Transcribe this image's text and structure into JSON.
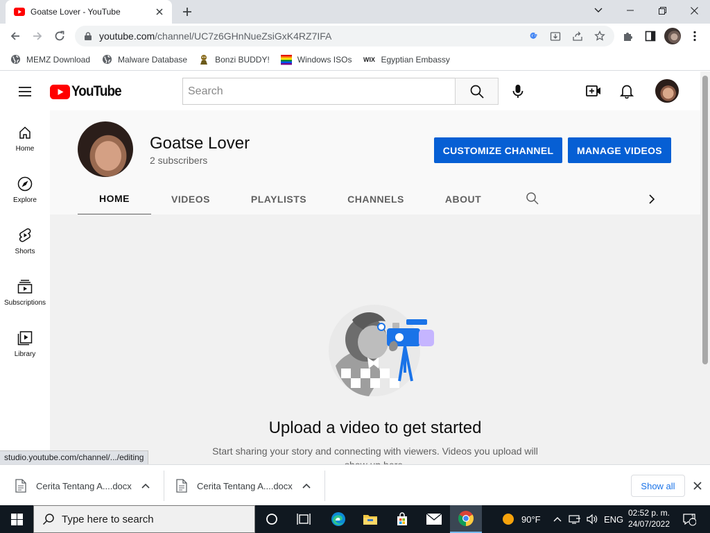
{
  "browser": {
    "tab_title": "Goatse Lover - YouTube",
    "url_host": "youtube.com",
    "url_path": "/channel/UC7z6GHnNueZsiGxK4RZ7IFA",
    "bookmarks": [
      {
        "label": "MEMZ Download",
        "icon": "globe-icon"
      },
      {
        "label": "Malware Database",
        "icon": "globe-icon"
      },
      {
        "label": "Bonzi BUDDY!",
        "icon": "bonzi-icon"
      },
      {
        "label": "Windows ISOs",
        "icon": "windows-flag-icon"
      },
      {
        "label": "Egyptian Embassy",
        "icon": "wix-icon"
      }
    ],
    "status_url": "studio.youtube.com/channel/.../editing"
  },
  "youtube": {
    "logo_text": "YouTube",
    "search_placeholder": "Search",
    "sidebar": [
      {
        "label": "Home",
        "icon": "home-icon"
      },
      {
        "label": "Explore",
        "icon": "compass-icon"
      },
      {
        "label": "Shorts",
        "icon": "shorts-icon"
      },
      {
        "label": "Subscriptions",
        "icon": "subscriptions-icon"
      },
      {
        "label": "Library",
        "icon": "library-icon"
      }
    ],
    "channel": {
      "name": "Goatse Lover",
      "subscribers": "2 subscribers",
      "customize_label": "CUSTOMIZE CHANNEL",
      "manage_label": "MANAGE VIDEOS",
      "tabs": [
        "HOME",
        "VIDEOS",
        "PLAYLISTS",
        "CHANNELS",
        "ABOUT"
      ],
      "active_tab": "HOME"
    },
    "empty_state": {
      "title": "Upload a video to get started",
      "subtitle": "Start sharing your story and connecting with viewers. Videos you upload will show up here."
    },
    "accent_color": "#065fd4",
    "brand_red": "#ff0000"
  },
  "downloads": {
    "items": [
      "Cerita Tentang A....docx",
      "Cerita Tentang A....docx"
    ],
    "show_all_label": "Show all"
  },
  "taskbar": {
    "search_placeholder": "Type here to search",
    "weather": "90°F",
    "language": "ENG",
    "time": "02:52 p. m.",
    "date": "24/07/2022",
    "notification_count": "1"
  }
}
